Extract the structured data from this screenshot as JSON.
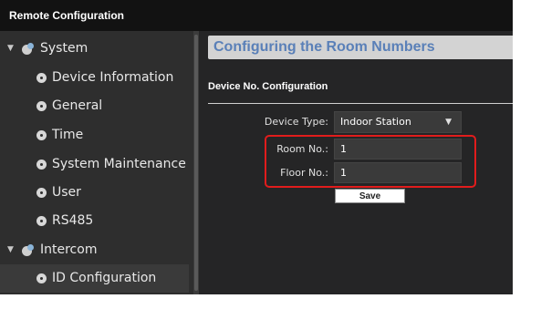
{
  "window": {
    "title": "Remote Configuration"
  },
  "sidebar": {
    "items": [
      {
        "label": "System",
        "type": "group",
        "expanded": true,
        "icon": "group-gear-icon"
      },
      {
        "label": "Device Information",
        "type": "leaf",
        "icon": "gear-icon"
      },
      {
        "label": "General",
        "type": "leaf",
        "icon": "gear-icon"
      },
      {
        "label": "Time",
        "type": "leaf",
        "icon": "gear-icon"
      },
      {
        "label": "System Maintenance",
        "type": "leaf",
        "icon": "gear-icon"
      },
      {
        "label": "User",
        "type": "leaf",
        "icon": "gear-icon"
      },
      {
        "label": "RS485",
        "type": "leaf",
        "icon": "gear-icon"
      },
      {
        "label": "Intercom",
        "type": "group",
        "expanded": true,
        "icon": "group-gear-icon"
      },
      {
        "label": "ID Configuration",
        "type": "leaf",
        "icon": "gear-icon",
        "selected": true
      }
    ]
  },
  "main": {
    "header": "Configuring the Room Numbers",
    "section_title": "Device No. Configuration",
    "form": {
      "device_type": {
        "label": "Device Type:",
        "value": "Indoor Station"
      },
      "room_no": {
        "label": "Room No.:",
        "value": "1"
      },
      "floor_no": {
        "label": "Floor No.:",
        "value": "1"
      }
    },
    "save_label": "Save"
  },
  "colors": {
    "highlight_border": "#e11c1c",
    "header_text": "#5a80b8",
    "titlebar_bg": "#121212",
    "panel_bg": "#252526"
  }
}
